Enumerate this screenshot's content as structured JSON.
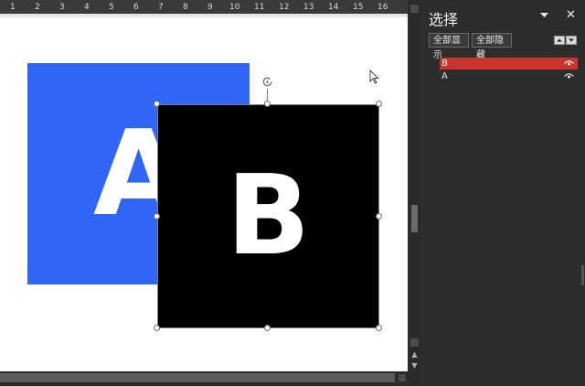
{
  "ruler": {
    "labels": [
      "1",
      "2",
      "3",
      "4",
      "5",
      "6",
      "7",
      "8",
      "9",
      "10",
      "11",
      "12",
      "13",
      "14",
      "15",
      "16"
    ]
  },
  "slide": {
    "shape_a": {
      "label": "A",
      "color": "#2f66f6"
    },
    "shape_b": {
      "label": "B",
      "color": "#000000"
    }
  },
  "panel": {
    "title": "选择",
    "show_all": "全部显示",
    "hide_all": "全部隐藏",
    "items": [
      {
        "name": "B",
        "selected": true
      },
      {
        "name": "A",
        "selected": false
      }
    ]
  },
  "colors": {
    "selected_row": "#c9342c",
    "panel_bg": "#2d2d2d",
    "accent_blue": "#2f66f6"
  }
}
